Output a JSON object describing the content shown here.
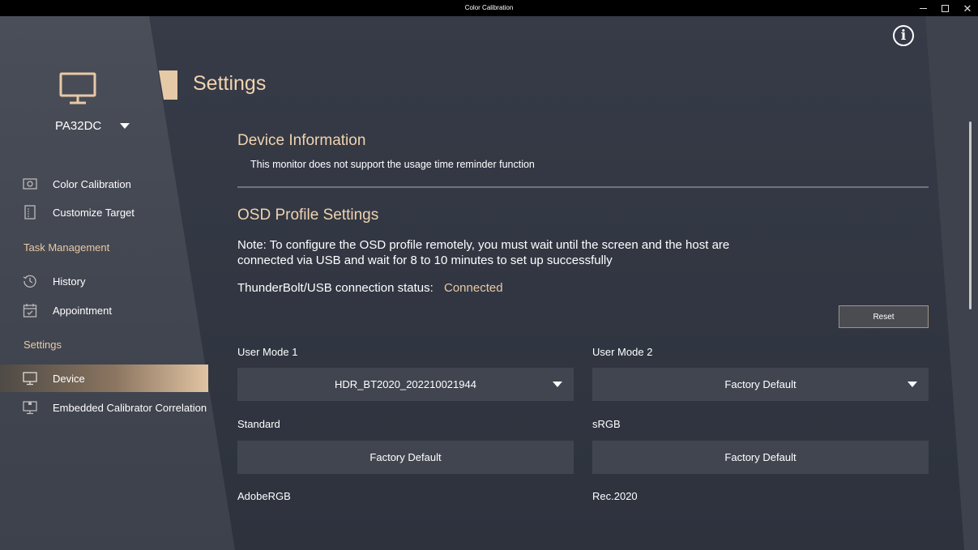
{
  "window": {
    "title": "Color Calibration"
  },
  "sidebar": {
    "device_name": "PA32DC",
    "items": [
      {
        "label": "Color Calibration",
        "icon": "camera-icon"
      },
      {
        "label": "Customize Target",
        "icon": "target-doc-icon"
      }
    ],
    "task_section": "Task Management",
    "task_items": [
      {
        "label": "History",
        "icon": "history-icon"
      },
      {
        "label": "Appointment",
        "icon": "calendar-icon"
      }
    ],
    "settings_section": "Settings",
    "settings_items": [
      {
        "label": "Device",
        "icon": "monitor-icon",
        "active": true
      },
      {
        "label": "Embedded Calibrator Correlation",
        "icon": "calibrator-icon"
      }
    ]
  },
  "header": {
    "title": "Settings"
  },
  "device_info": {
    "title": "Device Information",
    "message": "This monitor does not support the usage time reminder function"
  },
  "osd": {
    "title": "OSD Profile Settings",
    "note": "Note: To configure the OSD profile remotely, you must wait until the screen and the host are connected via USB and wait for 8 to 10 minutes to set up successfully",
    "status_label": "ThunderBolt/USB connection status:",
    "status_value": "Connected",
    "reset_label": "Reset",
    "fields": [
      {
        "label": "User Mode 1",
        "value": "HDR_BT2020_202210021944",
        "dropdown": true
      },
      {
        "label": "User Mode 2",
        "value": "Factory Default",
        "dropdown": true
      },
      {
        "label": "Standard",
        "value": "Factory Default",
        "dropdown": false
      },
      {
        "label": "sRGB",
        "value": "Factory Default",
        "dropdown": false
      },
      {
        "label": "AdobeRGB"
      },
      {
        "label": "Rec.2020"
      }
    ]
  },
  "colors": {
    "accent": "#e9c9a6",
    "background": "#2d323d",
    "panel": "#41454f"
  }
}
